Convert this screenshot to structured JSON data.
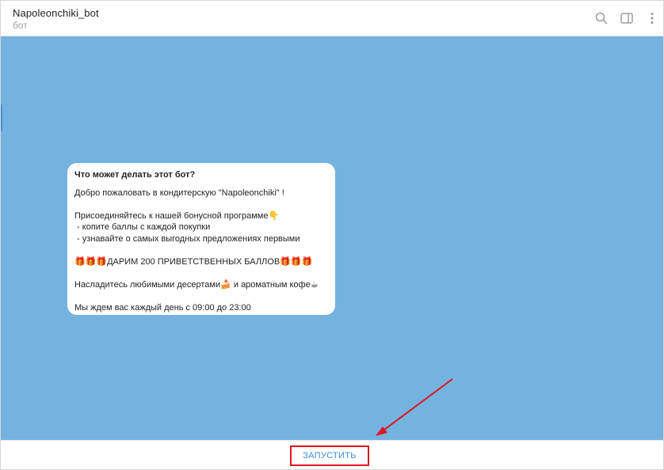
{
  "header": {
    "title": "Napoleonchiki_bot",
    "subtitle": "бот",
    "icons": [
      "search-icon",
      "sidebar-toggle-icon",
      "more-icon"
    ]
  },
  "bubble": {
    "heading": "Что может делать этот бот?",
    "line1": "Добро пожаловать в кондитерскую \"Napoleonchiki\" !",
    "line2": "Присоединяйтесь к нашей бонусной программе",
    "line2_emoji": "👇",
    "line3": " - копите баллы с каждой покупки",
    "line4": " - узнавайте о самых выгодных предложениях первыми",
    "gift_emoji": "🎁🎁🎁",
    "promo": "ДАРИМ 200 ПРИВЕТСТВЕННЫХ БАЛЛОВ",
    "line6a": "Насладитесь любимыми десертами",
    "cake_emoji": "🍰",
    "line6b": " и ароматным кофе",
    "coffee_emoji": "☕",
    "line7": "Мы ждем вас каждый день с 09:00 до 23:00"
  },
  "footer": {
    "start_label": "ЗАПУСТИТЬ"
  },
  "colors": {
    "chat_bg": "#74b3e0",
    "highlight": "#e0141e",
    "link": "#3a8fd6"
  }
}
